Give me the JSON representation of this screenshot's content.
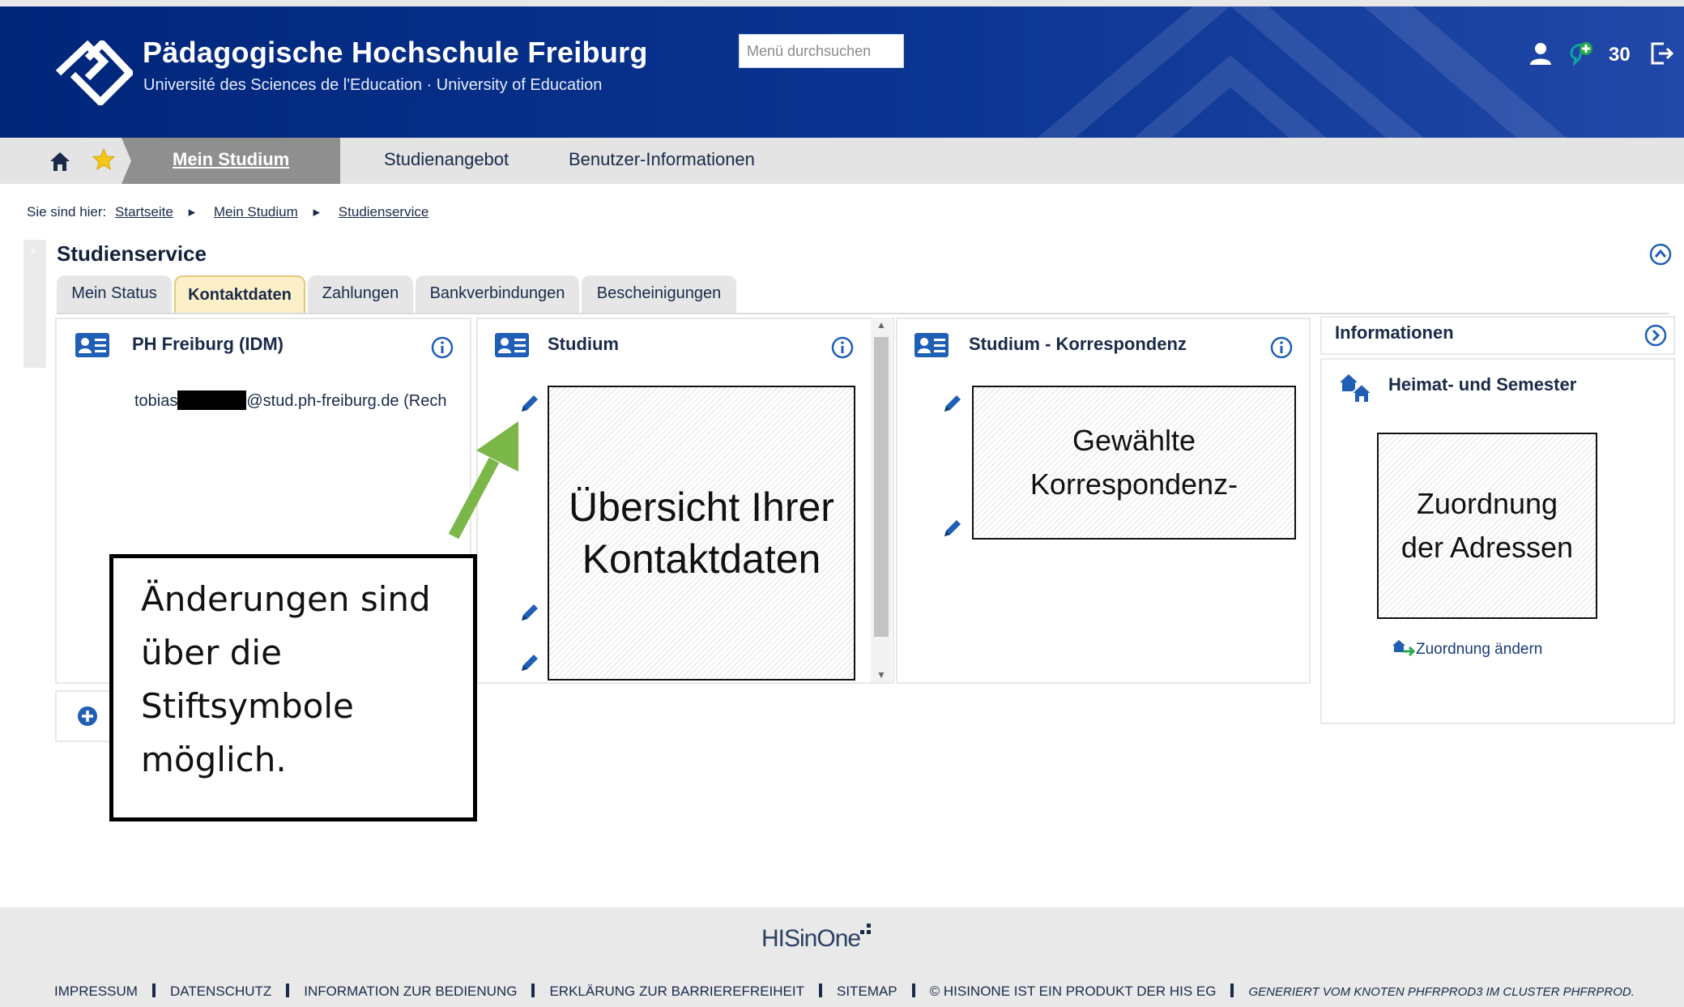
{
  "header": {
    "title": "Pädagogische Hochschule Freiburg",
    "subtitle": "Université des Sciences de l'Education · University of Education",
    "search_placeholder": "Menü durchsuchen",
    "notification_count": "30",
    "icons": [
      "person-icon",
      "chat-add-icon",
      "logout-icon"
    ]
  },
  "nav": {
    "items": [
      "Mein Studium",
      "Studienangebot",
      "Benutzer-Informationen"
    ],
    "active": "Mein Studium",
    "icons": [
      "home-icon",
      "star-icon"
    ]
  },
  "breadcrumb": {
    "prefix": "Sie sind hier:",
    "items": [
      "Startseite",
      "Mein Studium",
      "Studienservice"
    ]
  },
  "page": {
    "title": "Studienservice",
    "tabs": [
      "Mein Status",
      "Kontaktdaten",
      "Zahlungen",
      "Bankverbindungen",
      "Bescheinigungen"
    ],
    "active_tab": "Kontaktdaten"
  },
  "cards": {
    "idm": {
      "title": "PH Freiburg (IDM)",
      "email_prefix": "tobias",
      "email_suffix": "@stud.ph-freiburg.de (Rech"
    },
    "studium": {
      "title": "Studium",
      "overlay_text": "Übersicht Ihrer Kontaktdaten"
    },
    "korrespondenz": {
      "title": "Studium - Korrespondenz",
      "overlay_text": "Gewählte Korrespondenz-"
    }
  },
  "info_panel": {
    "title": "Informationen",
    "subtitle": "Heimat- und Semester",
    "overlay_text": "Zuordnung der Adressen",
    "link": "Zuordnung ändern"
  },
  "callout": {
    "text": "Änderungen sind über die Stiftsymbole möglich."
  },
  "footer": {
    "logo": "HISinOne",
    "links": [
      "IMPRESSUM",
      "DATENSCHUTZ",
      "INFORMATION ZUR BEDIENUNG",
      "ERKLÄRUNG ZUR BARRIEREFREIHEIT",
      "SITEMAP",
      "© HISINONE IST EIN PRODUKT DER HIS EG"
    ],
    "generated": "GENERIERT VOM KNOTEN PHFRPROD3 IM CLUSTER PHFRPROD."
  },
  "colors": {
    "header_blue": "#0b3592",
    "accent_green": "#7ab648",
    "active_tab_bg": "#fdf0c9",
    "nav_active": "#8f8f8f",
    "icon_blue": "#1f5fb5"
  }
}
